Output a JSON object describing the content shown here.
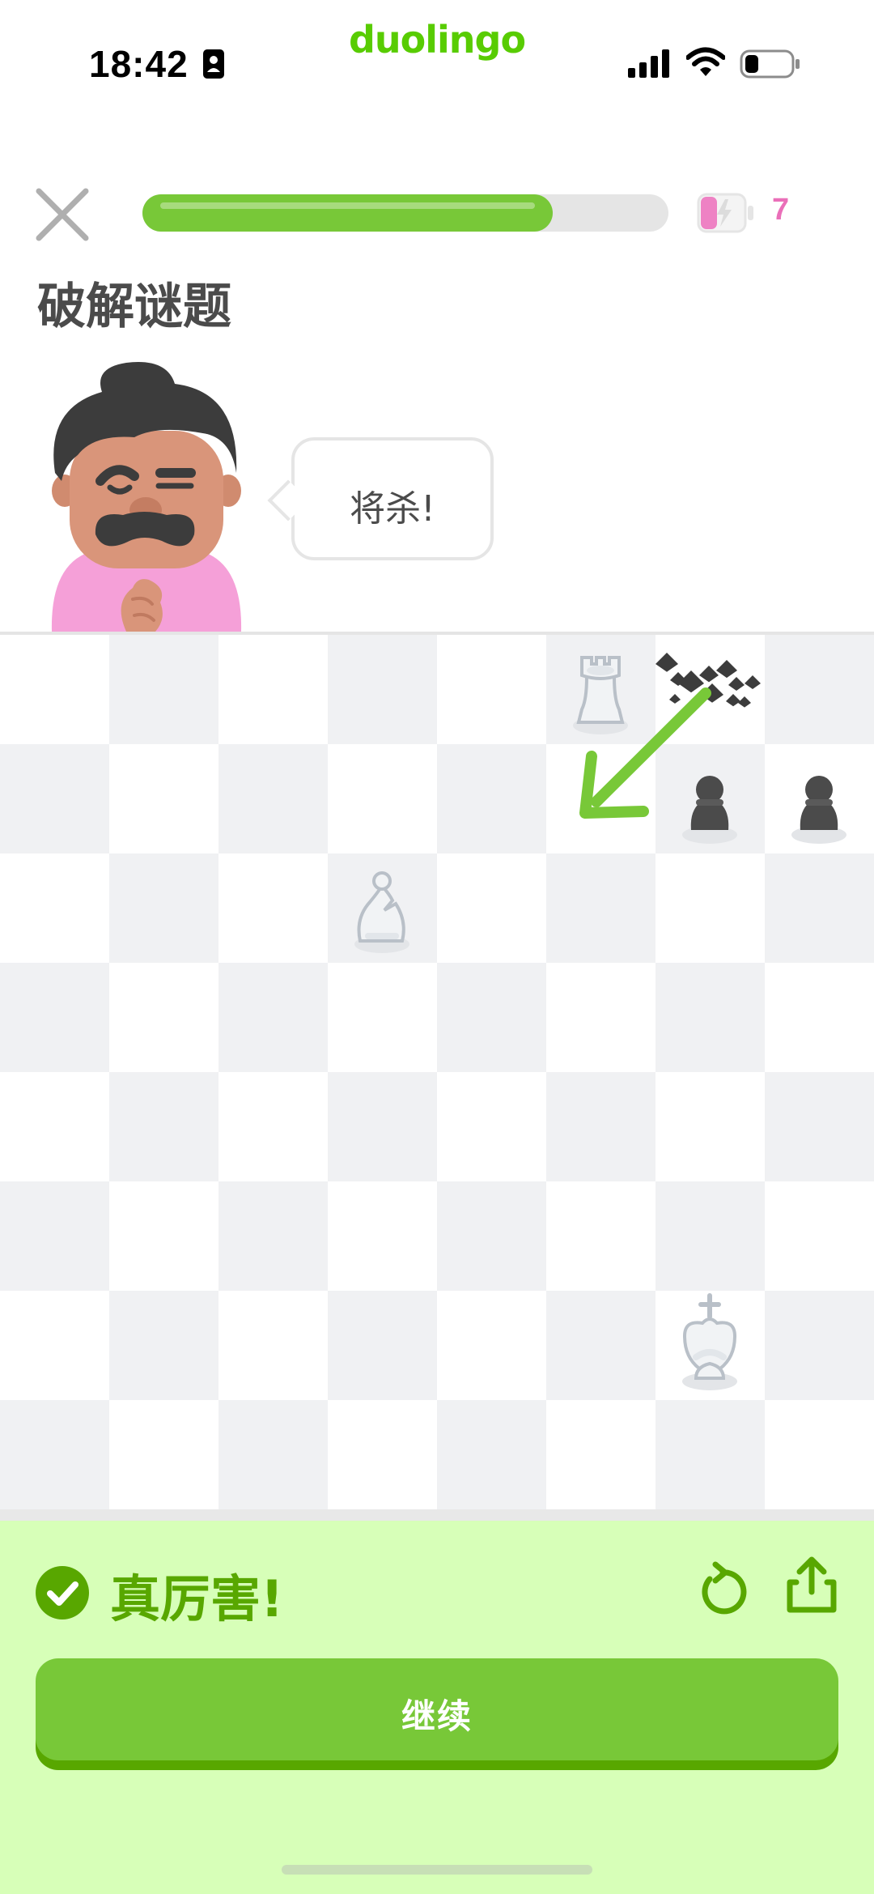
{
  "status_bar": {
    "time": "18:42",
    "contact_icon": "person-card-icon",
    "signal_icon": "cellular-signal-icon",
    "wifi_icon": "wifi-icon",
    "battery_icon": "battery-icon"
  },
  "app": {
    "logo": "duolingo"
  },
  "lesson": {
    "close_icon": "close-icon",
    "progress_fraction": 0.78,
    "energy_icon": "energy-battery-icon",
    "energy_count": "7",
    "title": "破解谜题"
  },
  "character": {
    "name_icon": "mustache-character-icon",
    "speech": "将杀!"
  },
  "board": {
    "light_color": "#ffffff",
    "dark_color": "#f0f1f3",
    "pieces": [
      {
        "type": "rook",
        "color": "white",
        "square": "f8"
      },
      {
        "type": "pawn",
        "color": "black",
        "square": "g7"
      },
      {
        "type": "pawn",
        "color": "black",
        "square": "h7"
      },
      {
        "type": "bishop",
        "color": "white",
        "square": "d6"
      },
      {
        "type": "king",
        "color": "white",
        "square": "g2"
      }
    ],
    "captured_square": "g8",
    "move_arrow": {
      "from": "g8",
      "to": "f7",
      "color": "#78c838"
    }
  },
  "result": {
    "check_icon": "check-circle-icon",
    "title": "真厉害!",
    "retry_icon": "retry-icon",
    "share_icon": "share-icon",
    "continue_label": "继续",
    "panel_color": "#d7ffb8",
    "accent_color": "#58a700"
  }
}
